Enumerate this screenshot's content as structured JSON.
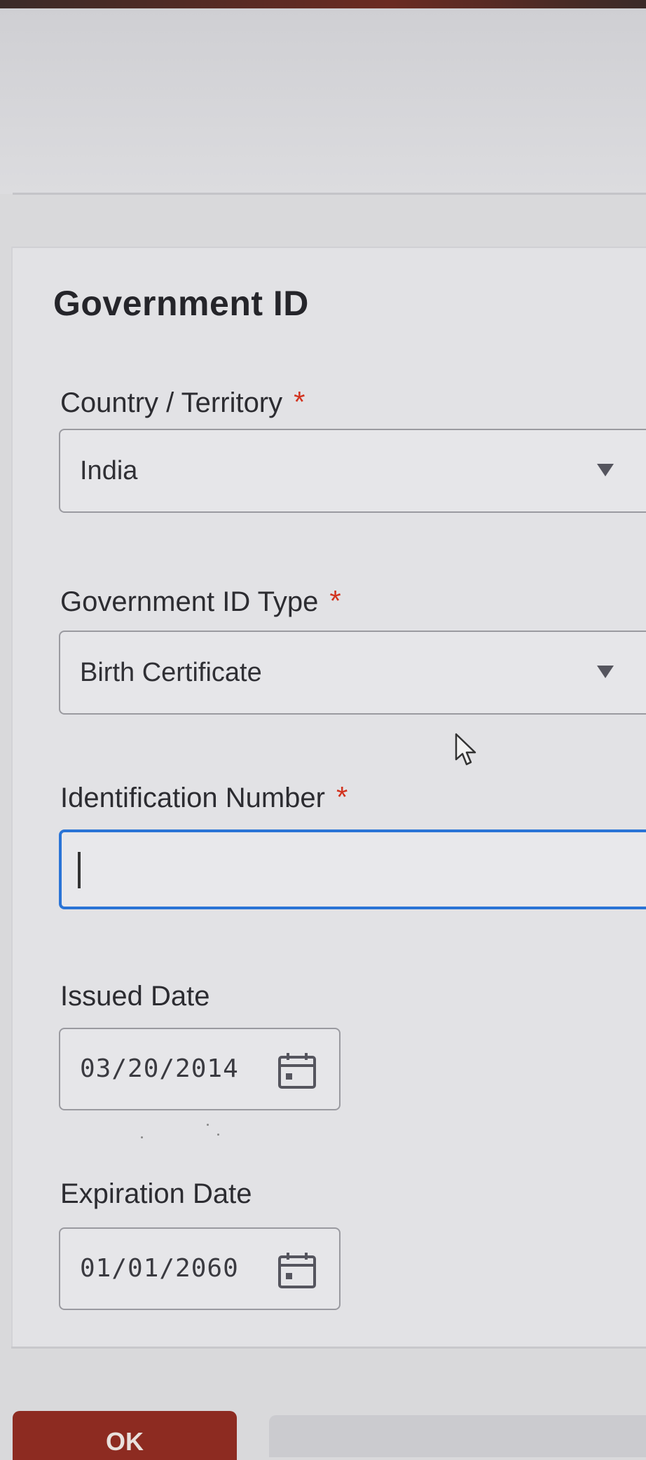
{
  "form": {
    "title": "Government ID",
    "required_marker": "*",
    "country": {
      "label": "Country / Territory",
      "value": "India"
    },
    "id_type": {
      "label": "Government ID Type",
      "value": "Birth Certificate"
    },
    "id_number": {
      "label": "Identification Number",
      "value": ""
    },
    "issued_date": {
      "label": "Issued Date",
      "value": "03/20/2014"
    },
    "expiration_date": {
      "label": "Expiration Date",
      "value": "01/01/2060"
    }
  },
  "footer": {
    "ok_label": "OK"
  },
  "icons": {
    "dropdown": "chevron-down-icon",
    "date": "calendar-icon",
    "cursor": "mouse-cursor-icon"
  },
  "colors": {
    "required": "#d2331f",
    "focus_border": "#2a74d6",
    "primary_button": "#8d2b21"
  }
}
